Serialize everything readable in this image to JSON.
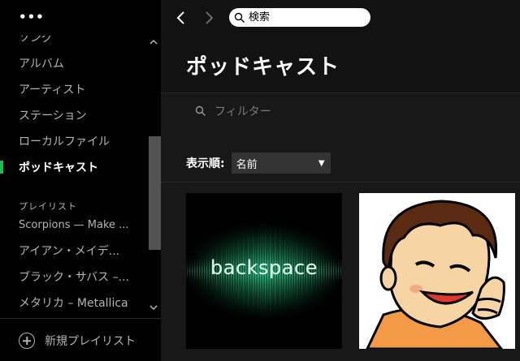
{
  "sidebar": {
    "more_menu": "•••",
    "items": [
      {
        "label": "ソング"
      },
      {
        "label": "アルバム"
      },
      {
        "label": "アーティスト"
      },
      {
        "label": "ステーション"
      },
      {
        "label": "ローカルファイル"
      },
      {
        "label": "ポッドキャスト",
        "active": true
      }
    ],
    "playlists_header": "プレイリスト",
    "playlists": [
      {
        "label": "Scorpions — Make ..."
      },
      {
        "label": "アイアン・メイデ..."
      },
      {
        "label": "ブラック・サバス –..."
      },
      {
        "label": "メタリカ – Metallica"
      }
    ],
    "new_playlist_label": "新規プレイリスト"
  },
  "topbar": {
    "search_placeholder": "検索"
  },
  "main": {
    "title": "ポッドキャスト",
    "filter_placeholder": "フィルター",
    "sort_label": "表示順:",
    "sort_value": "名前",
    "cards": [
      {
        "text": "backspace"
      },
      {
        "text": ""
      }
    ]
  },
  "colors": {
    "accent": "#1db954",
    "sidebar_bg": "#000000",
    "main_bg": "#181818"
  }
}
